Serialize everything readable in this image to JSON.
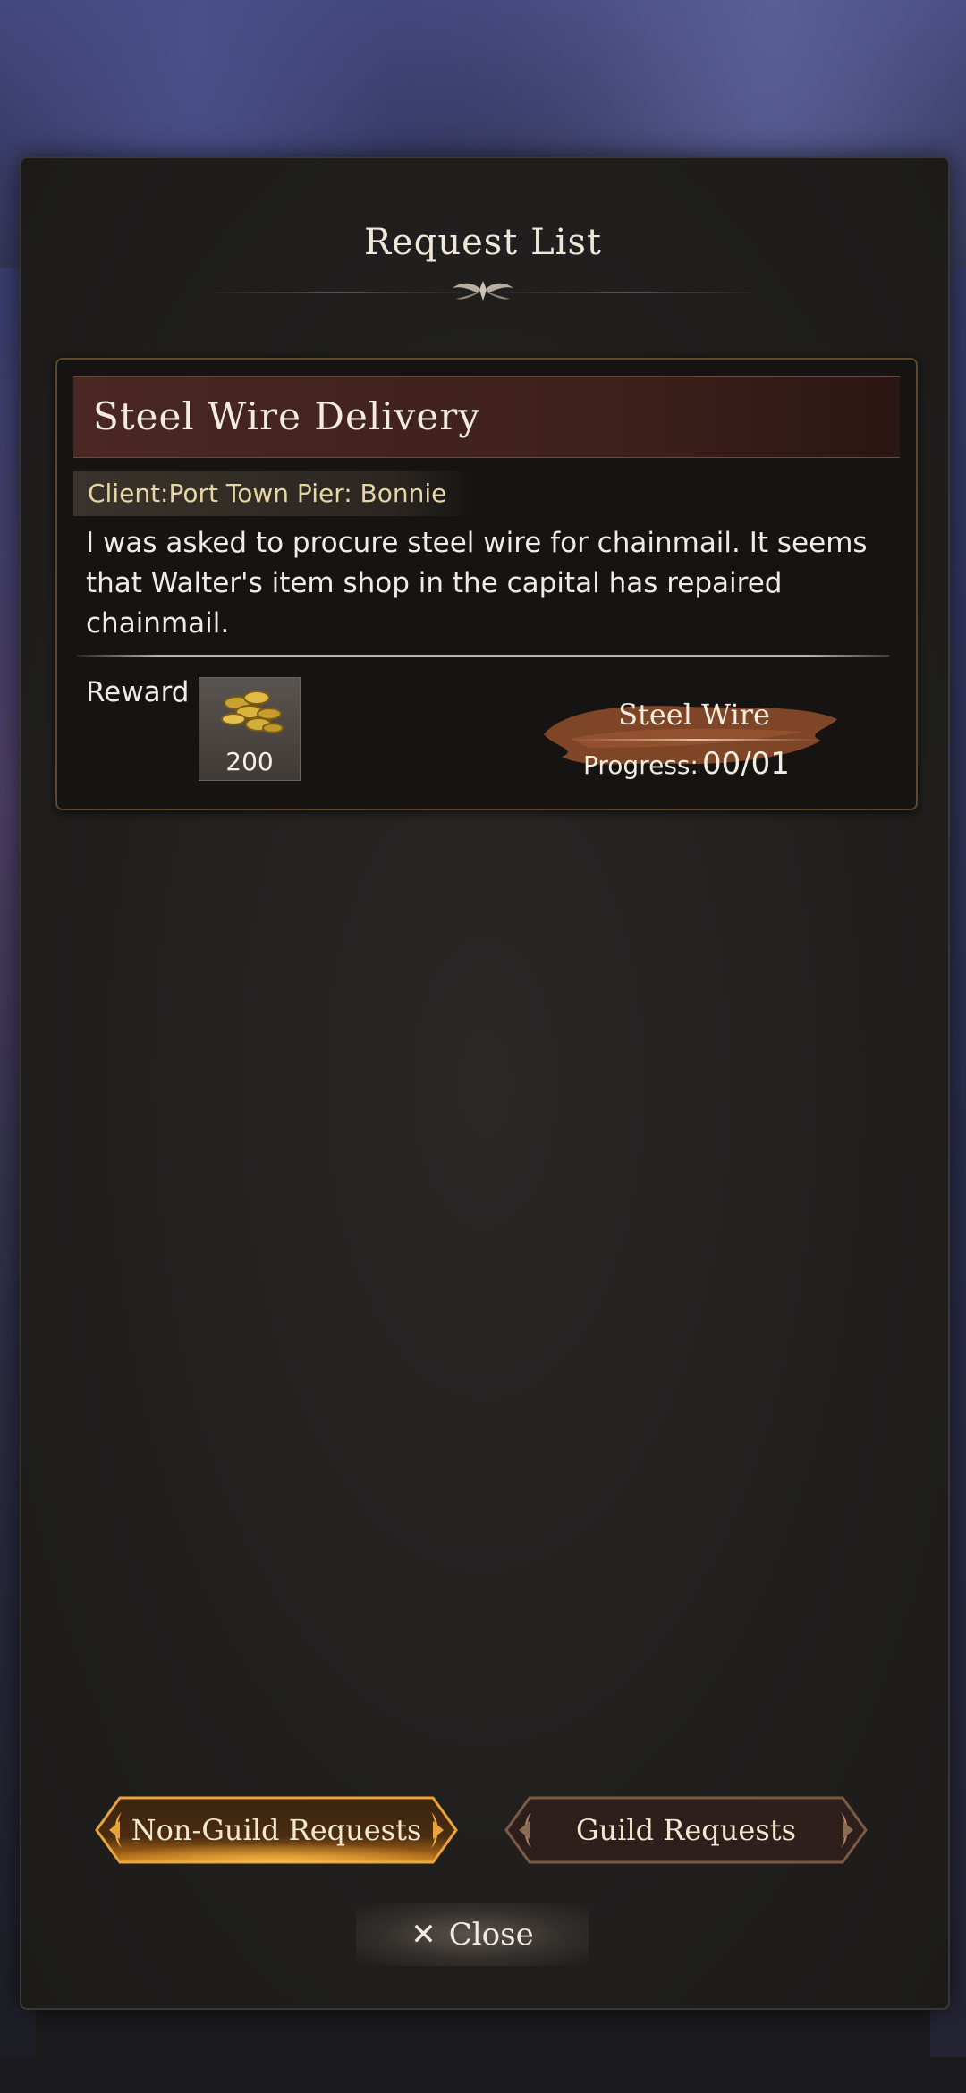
{
  "screen": {
    "title": "Request List"
  },
  "request": {
    "title": "Steel Wire Delivery",
    "client_label": "Client:",
    "client": "Port Town Pier: Bonnie",
    "description": "I was asked to procure steel wire for chainmail. It seems that Walter's item shop in the capital has repaired chainmail.",
    "reward_label": "Reward",
    "reward_amount": "200",
    "reward_icon": "gold-coins-icon",
    "target_item": "Steel Wire",
    "progress_label": "Progress:",
    "progress_value": "00/01"
  },
  "tabs": [
    {
      "label": "Non-Guild Requests",
      "active": true
    },
    {
      "label": "Guild Requests",
      "active": false
    }
  ],
  "close": {
    "icon": "close-icon",
    "label": "Close"
  },
  "colors": {
    "accent_gold": "#e8a43a",
    "header_red": "#4a2723",
    "brush_orange": "#8a4a2a"
  }
}
